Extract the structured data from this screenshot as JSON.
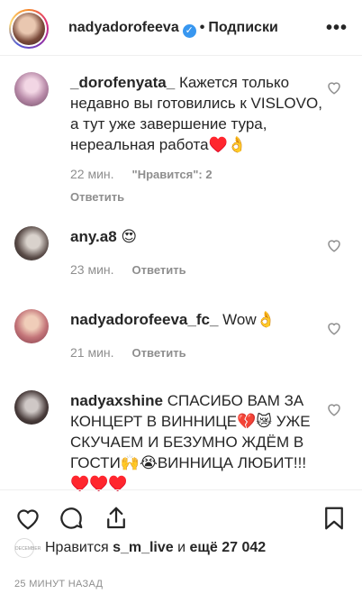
{
  "header": {
    "username": "nadyadorofeeva",
    "separator": "•",
    "follow_label": "Подписки",
    "more_glyph": "•••",
    "verified_glyph": "✓"
  },
  "comments": [
    {
      "username": "_dorofenyata_",
      "text": "Кажется только недавно вы готовились к VISLOVO, а тут уже завершение тура, нереальная работа♥️👌",
      "time": "22 мин.",
      "likes": "\"Нравится\": 2",
      "reply": "Ответить"
    },
    {
      "username": "any.a8",
      "text": "😍",
      "time": "23 мин.",
      "reply": "Ответить"
    },
    {
      "username": "nadyadorofeeva_fc_",
      "text": "Wow👌",
      "time": "21 мин.",
      "reply": "Ответить"
    },
    {
      "username": "nadyaxshine",
      "text": "СПАСИБО ВАМ ЗА КОНЦЕРТ В ВИННИЦЕ💔😿 УЖЕ СКУЧАЕМ И БЕЗУМНО ЖДЁМ В ГОСТИ🙌😭ВИННИЦА ЛЮБИТ!!! ♥️♥️♥️"
    }
  ],
  "likes_bar": {
    "avatar_text": "DECEMBER",
    "prefix": "Нравится",
    "user": "s_m_live",
    "conj": "и",
    "count_text": "ещё 27 042"
  },
  "timestamp": "25 МИНУТ НАЗАД",
  "colors": {
    "verified": "#3897f0",
    "meta": "#8e8e8e",
    "text": "#262626"
  }
}
